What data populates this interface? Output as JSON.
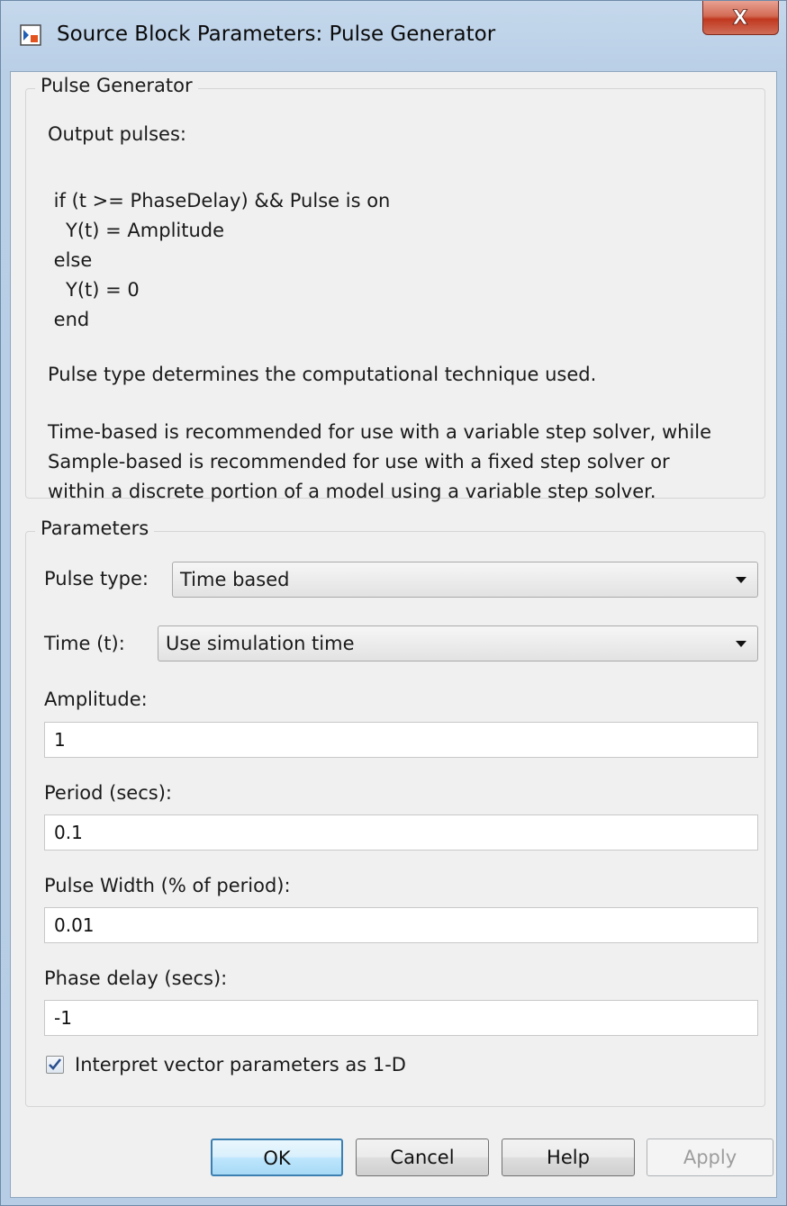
{
  "window": {
    "title": "Source Block Parameters: Pulse Generator",
    "icon": "simulink-block-icon",
    "close_icon": "close-icon",
    "close_glyph": "X"
  },
  "description": {
    "group_title": "Pulse Generator",
    "lines": [
      "Output pulses:",
      "",
      " if (t >= PhaseDelay) && Pulse is on",
      "   Y(t) = Amplitude",
      " else",
      "   Y(t) = 0",
      " end",
      "",
      "Pulse type determines the computational technique used.",
      "",
      "Time-based is recommended for use with a variable step solver, while",
      "Sample-based is recommended for use with a fixed step solver or",
      "within a discrete portion of a model using a variable step solver."
    ]
  },
  "parameters": {
    "group_title": "Parameters",
    "pulse_type": {
      "label": "Pulse type:",
      "value": "Time based"
    },
    "time": {
      "label": "Time (t):",
      "value": "Use simulation time"
    },
    "amplitude": {
      "label": "Amplitude:",
      "value": "1"
    },
    "period": {
      "label": "Period (secs):",
      "value": "0.1"
    },
    "pulse_width": {
      "label": "Pulse Width (% of period):",
      "value": "0.01"
    },
    "phase_delay": {
      "label": "Phase delay (secs):",
      "value": "-1"
    },
    "interpret_vector": {
      "label": "Interpret vector parameters as 1-D",
      "checked": true
    }
  },
  "buttons": {
    "ok": "OK",
    "cancel": "Cancel",
    "help": "Help",
    "apply": "Apply"
  }
}
